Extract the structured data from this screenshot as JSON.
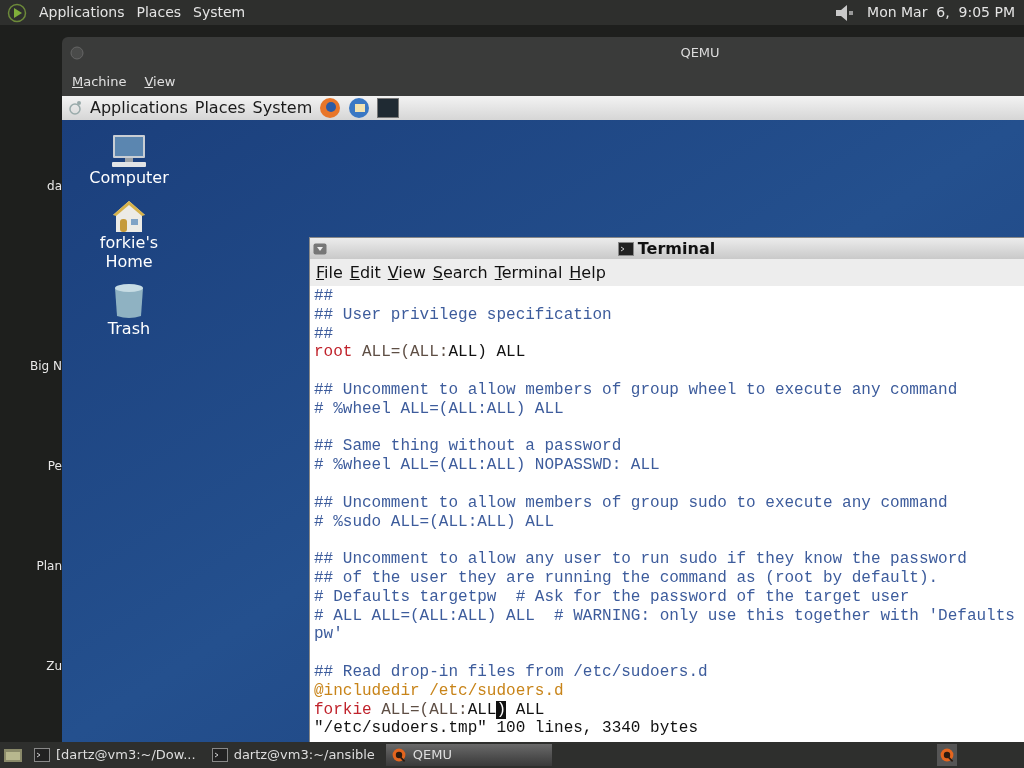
{
  "host_panel": {
    "menus": [
      "Applications",
      "Places",
      "System"
    ],
    "clock": "Mon Mar  6,  9:05 PM"
  },
  "host_desktop_labels": [
    "da",
    "Big N",
    "Pe",
    "Plan",
    "Zu"
  ],
  "qemu": {
    "title": "QEMU",
    "menus": [
      "Machine",
      "View"
    ]
  },
  "guest_panel": {
    "menus": [
      "Applications",
      "Places",
      "System"
    ]
  },
  "desktop_icons": [
    {
      "label": "Computer",
      "kind": "computer"
    },
    {
      "label": "forkie's Home",
      "kind": "home"
    },
    {
      "label": "Trash",
      "kind": "trash"
    }
  ],
  "terminal": {
    "title": "Terminal",
    "menus": [
      "File",
      "Edit",
      "View",
      "Search",
      "Terminal",
      "Help"
    ],
    "lines": [
      {
        "kind": "code",
        "segments": [
          {
            "text": "##",
            "kind": "comment"
          }
        ]
      },
      {
        "kind": "code",
        "segments": [
          {
            "text": "## User privilege specification",
            "kind": "comment"
          }
        ]
      },
      {
        "kind": "code",
        "segments": [
          {
            "text": "##",
            "kind": "comment"
          }
        ]
      },
      {
        "kind": "code",
        "segments": [
          {
            "text": "root",
            "kind": "keyword"
          },
          {
            "text": " ALL=(ALL:",
            "kind": "muted"
          },
          {
            "text": "ALL) ALL",
            "kind": "plain"
          }
        ]
      },
      {
        "kind": "blank"
      },
      {
        "kind": "code",
        "segments": [
          {
            "text": "## Uncomment to allow members of group wheel to execute any command",
            "kind": "comment"
          }
        ]
      },
      {
        "kind": "code",
        "segments": [
          {
            "text": "# %wheel ALL=(ALL:ALL) ALL",
            "kind": "comment"
          }
        ]
      },
      {
        "kind": "blank"
      },
      {
        "kind": "code",
        "segments": [
          {
            "text": "## Same thing without a password",
            "kind": "comment"
          }
        ]
      },
      {
        "kind": "code",
        "segments": [
          {
            "text": "# %wheel ALL=(ALL:ALL) NOPASSWD: ALL",
            "kind": "comment"
          }
        ]
      },
      {
        "kind": "blank"
      },
      {
        "kind": "code",
        "segments": [
          {
            "text": "## Uncomment to allow members of group sudo to execute any command",
            "kind": "comment"
          }
        ]
      },
      {
        "kind": "code",
        "segments": [
          {
            "text": "# %sudo ALL=(ALL:ALL) ALL",
            "kind": "comment"
          }
        ]
      },
      {
        "kind": "blank"
      },
      {
        "kind": "code",
        "segments": [
          {
            "text": "## Uncomment to allow any user to run sudo if they know the password",
            "kind": "comment"
          }
        ]
      },
      {
        "kind": "code",
        "segments": [
          {
            "text": "## of the user they are running the command as (root by default).",
            "kind": "comment"
          }
        ]
      },
      {
        "kind": "code",
        "segments": [
          {
            "text": "# Defaults targetpw  # Ask for the password of the target user",
            "kind": "comment"
          }
        ]
      },
      {
        "kind": "code",
        "segments": [
          {
            "text": "# ALL ALL=(ALL:ALL) ALL  # WARNING: only use this together with 'Defaults",
            "kind": "comment"
          }
        ]
      },
      {
        "kind": "code",
        "segments": [
          {
            "text": "pw'",
            "kind": "comment"
          }
        ]
      },
      {
        "kind": "blank"
      },
      {
        "kind": "code",
        "segments": [
          {
            "text": "## Read drop-in files from /etc/sudoers.d",
            "kind": "comment"
          }
        ]
      },
      {
        "kind": "code",
        "segments": [
          {
            "text": "@includedir /etc/sudoers.d",
            "kind": "include"
          }
        ]
      },
      {
        "kind": "code",
        "segments": [
          {
            "text": "forkie",
            "kind": "keyword"
          },
          {
            "text": " ALL=(ALL:",
            "kind": "muted"
          },
          {
            "text": "ALL",
            "kind": "plain"
          },
          {
            "text": ")",
            "kind": "cursor"
          },
          {
            "text": " ALL",
            "kind": "plain"
          }
        ]
      },
      {
        "kind": "code",
        "segments": [
          {
            "text": "\"/etc/sudoers.tmp\" 100 lines, 3340 bytes",
            "kind": "plain"
          }
        ]
      }
    ]
  },
  "taskbar": {
    "items": [
      {
        "label": "[dartz@vm3:~/Dow...",
        "kind": "terminal",
        "selected": false
      },
      {
        "label": "dartz@vm3:~/ansible",
        "kind": "terminal",
        "selected": false
      },
      {
        "label": "QEMU",
        "kind": "qemu",
        "selected": true
      }
    ]
  }
}
